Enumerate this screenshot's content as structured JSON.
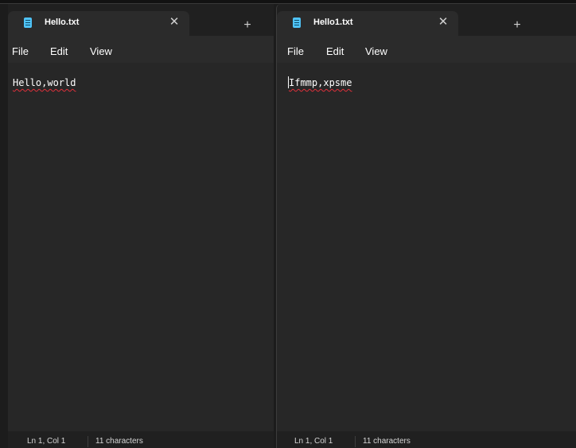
{
  "windows": {
    "left": {
      "tab_title": "Hello.txt",
      "close_glyph": "✕",
      "new_tab_glyph": "+",
      "menu": {
        "file": "File",
        "edit": "Edit",
        "view": "View"
      },
      "content": "Hello,world",
      "status": {
        "position": "Ln 1, Col 1",
        "characters": "11 characters"
      }
    },
    "right": {
      "tab_title": "Hello1.txt",
      "close_glyph": "✕",
      "new_tab_glyph": "+",
      "menu": {
        "file": "File",
        "edit": "Edit",
        "view": "View"
      },
      "content": "Ifmmp,xpsme",
      "status": {
        "position": "Ln 1, Col 1",
        "characters": "11 characters"
      }
    }
  },
  "colors": {
    "background": "#272727",
    "titlebar": "#202020",
    "accent_icon": "#4fc3f7",
    "spellcheck_underline": "#e0303a"
  },
  "icons": {
    "document": "notepad-document-icon",
    "close": "close-icon",
    "new_tab": "plus-icon"
  }
}
